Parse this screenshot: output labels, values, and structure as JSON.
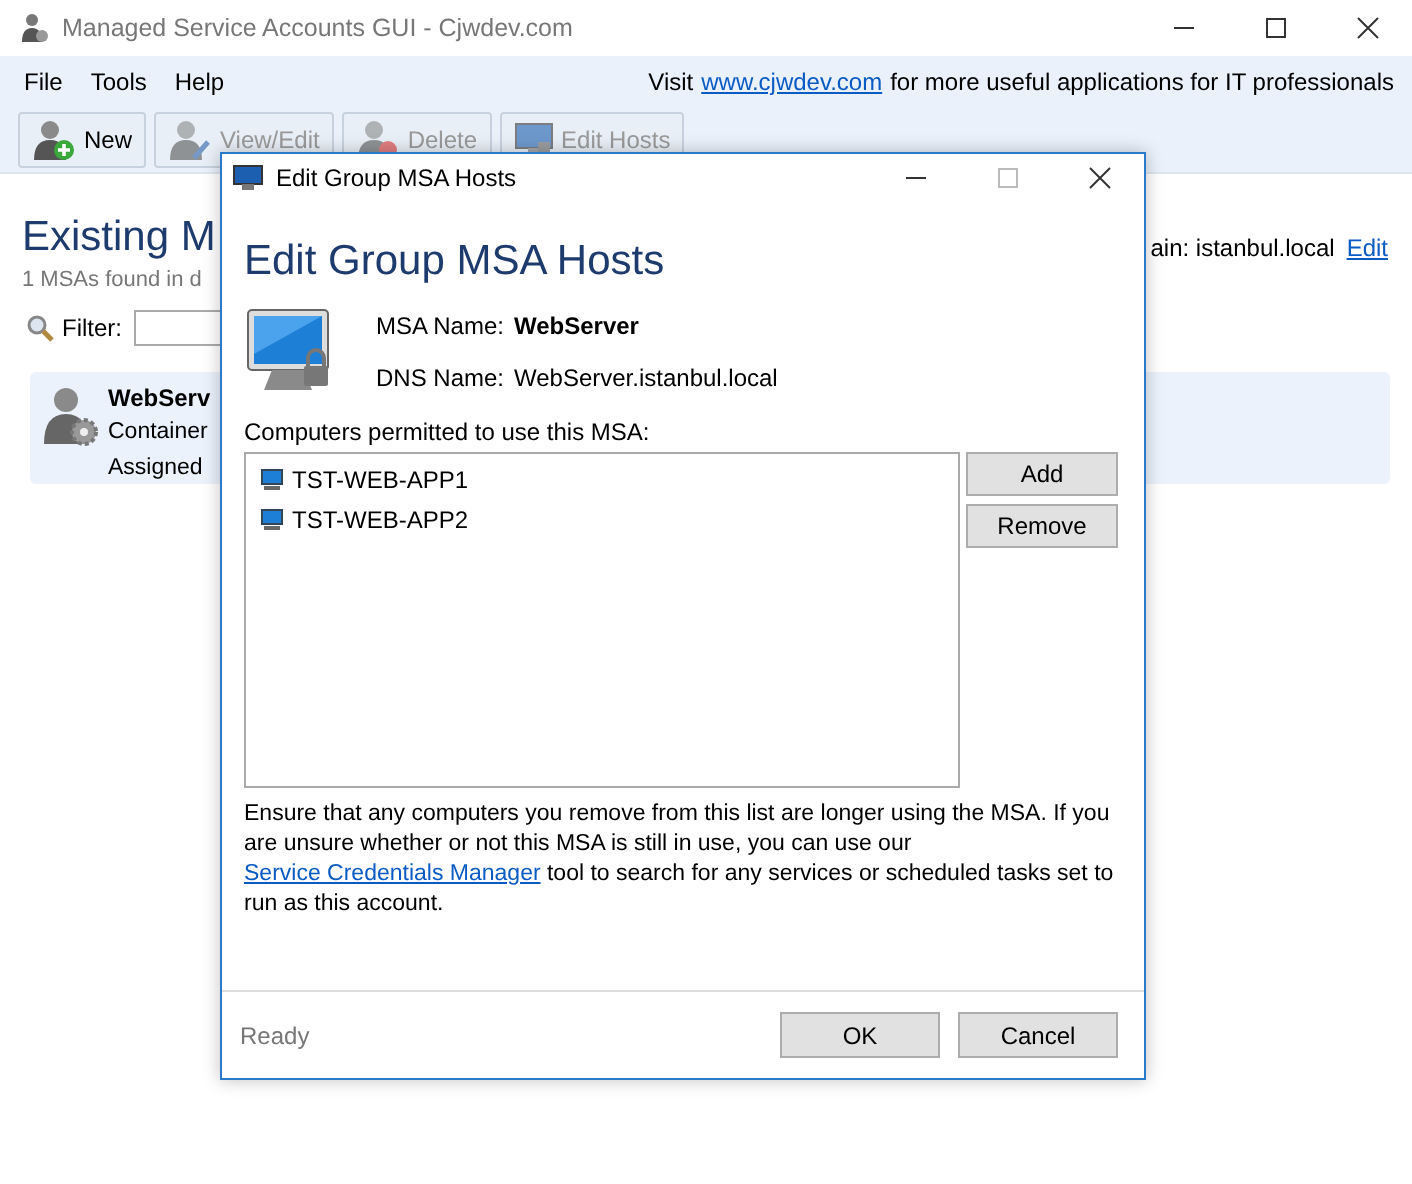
{
  "window": {
    "title": "Managed Service Accounts GUI - Cjwdev.com"
  },
  "menu": [
    "File",
    "Tools",
    "Help"
  ],
  "notice": {
    "before": "Visit",
    "link": "www.cjwdev.com",
    "after": "for more useful applications for IT professionals"
  },
  "toolbar": [
    {
      "label": "New",
      "kind": "new",
      "disabled": false
    },
    {
      "label": "View/Edit",
      "kind": "edit",
      "disabled": true
    },
    {
      "label": "Delete",
      "kind": "delete",
      "disabled": true
    },
    {
      "label": "Edit Hosts",
      "kind": "hosts",
      "disabled": true
    }
  ],
  "main": {
    "heading": "Existing M",
    "summary": "1 MSAs found in d",
    "domain_label": "ain: istanbul.local",
    "domain_edit": "Edit",
    "filter_label": "Filter:",
    "accounts": [
      {
        "name": "WebServ",
        "line_2": "Container",
        "line_3": "Assigned",
        "selected": true
      }
    ]
  },
  "dialog": {
    "title": "Edit Group MSA Hosts",
    "heading": "Edit Group MSA Hosts",
    "fields": [
      {
        "label": "MSA Name:",
        "value": "WebServer",
        "bold": true
      },
      {
        "label": "DNS Name:",
        "value": "WebServer.istanbul.local",
        "bold": false
      }
    ],
    "list_label": "Computers permitted to use this MSA:",
    "computers": [
      "TST-WEB-APP1",
      "TST-WEB-APP2"
    ],
    "side_buttons": [
      "Add",
      "Remove"
    ],
    "note": {
      "before": "Ensure that any computers you remove from this list are longer using the MSA. If you are unsure whether or not this MSA is still in use, you can use our",
      "link": "Service Credentials Manager",
      "after": "tool to search for any services or scheduled tasks set to run as this account."
    },
    "status": "Ready",
    "buttons": [
      "OK",
      "Cancel"
    ]
  }
}
